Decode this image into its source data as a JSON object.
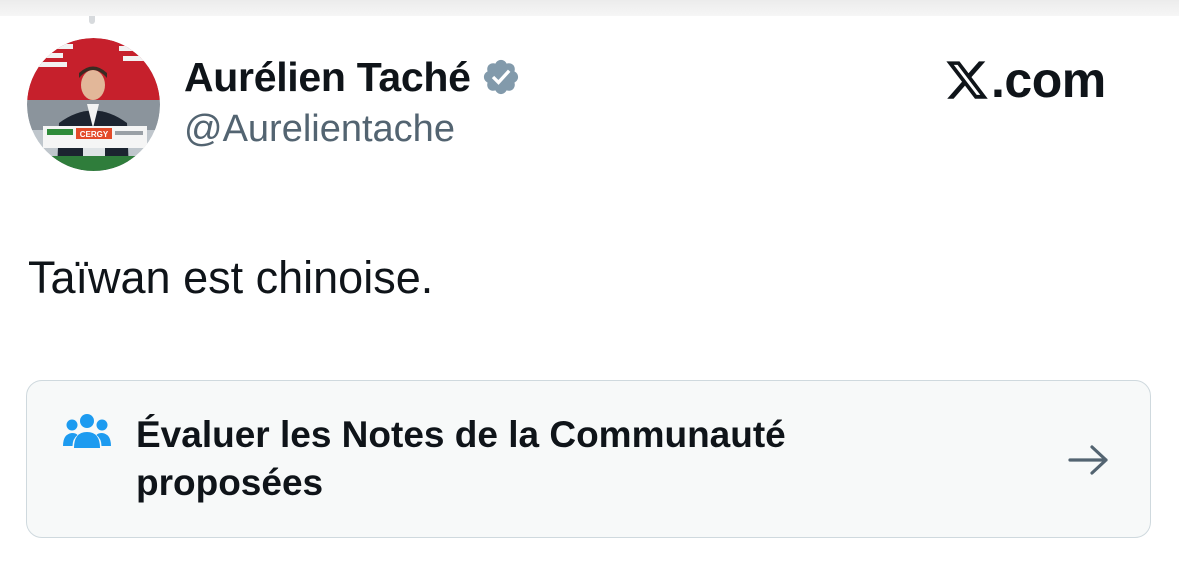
{
  "author": {
    "name": "Aurélien Taché",
    "handle": "@Aurelientache",
    "verified": true,
    "badge_color": "#829aab",
    "avatar_sign_text": "CERGY"
  },
  "brand": {
    "icon": "x-logo-icon",
    "domain": ".com"
  },
  "tweet": {
    "text": "Taïwan est chinoise."
  },
  "community_notes": {
    "label": "Évaluer les Notes de la Communauté proposées",
    "icon": "people-icon",
    "icon_color": "#1d9bf0",
    "arrow_icon": "arrow-right-icon"
  },
  "colors": {
    "text_primary": "#0f1419",
    "text_secondary": "#536471",
    "card_background": "#f7f9f9",
    "card_border": "#cfd9de"
  }
}
